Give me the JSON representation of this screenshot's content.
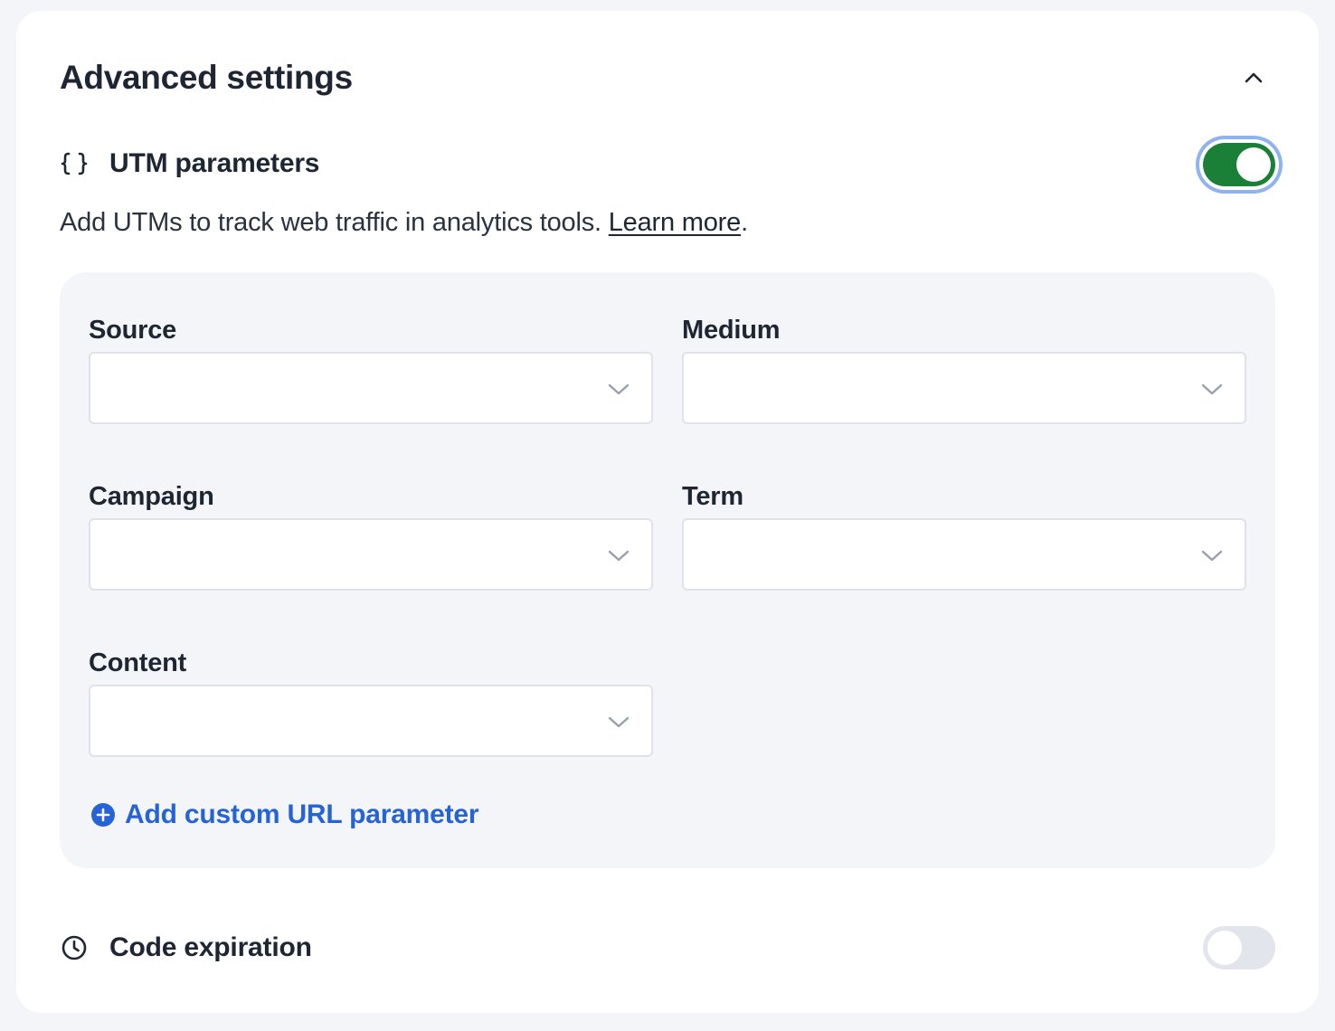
{
  "section": {
    "title": "Advanced settings",
    "collapse_icon": "chevron-up-icon"
  },
  "utm": {
    "icon": "curly-braces-icon",
    "label": "UTM parameters",
    "enabled": true,
    "description": "Add UTMs to track web traffic in analytics tools.",
    "learn_more": "Learn more",
    "description_suffix": ".",
    "fields": {
      "source": {
        "label": "Source",
        "value": ""
      },
      "medium": {
        "label": "Medium",
        "value": ""
      },
      "campaign": {
        "label": "Campaign",
        "value": ""
      },
      "term": {
        "label": "Term",
        "value": ""
      },
      "content": {
        "label": "Content",
        "value": ""
      }
    },
    "add_custom": "Add custom URL parameter"
  },
  "expiration": {
    "icon": "clock-icon",
    "label": "Code expiration",
    "enabled": false
  },
  "colors": {
    "toggle_on": "#1a7f37",
    "toggle_off": "#e2e5eb",
    "link_blue": "#2563d6",
    "focus_ring": "#8fb2f0"
  }
}
